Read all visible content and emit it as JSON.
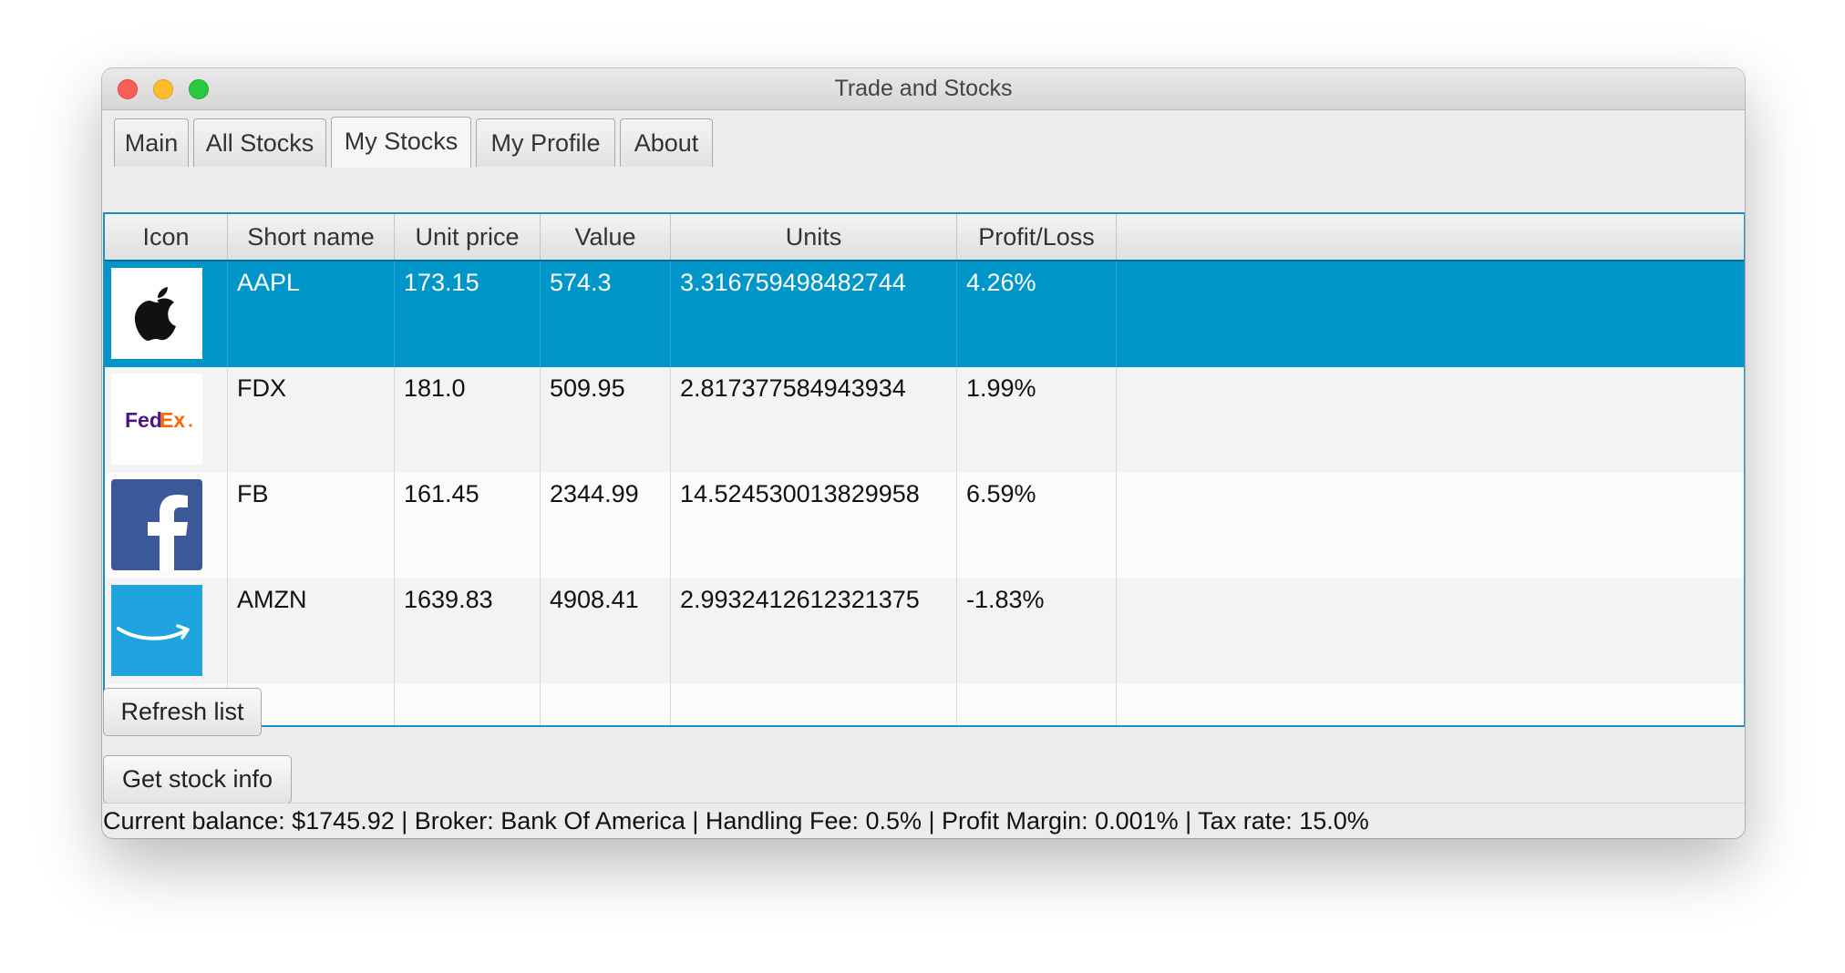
{
  "window": {
    "title": "Trade and Stocks"
  },
  "tabs": [
    {
      "label": "Main"
    },
    {
      "label": "All Stocks"
    },
    {
      "label": "My Stocks",
      "selected": true
    },
    {
      "label": "My Profile"
    },
    {
      "label": "About"
    }
  ],
  "table": {
    "columns": [
      "Icon",
      "Short name",
      "Unit price",
      "Value",
      "Units",
      "Profit/Loss"
    ],
    "rows": [
      {
        "icon": "apple-logo-icon",
        "short_name": "AAPL",
        "unit_price": "173.15",
        "value": "574.3",
        "units": "3.316759498482744",
        "profit_loss": "4.26%",
        "selected": true
      },
      {
        "icon": "fedex-logo-icon",
        "short_name": "FDX",
        "unit_price": "181.0",
        "value": "509.95",
        "units": "2.817377584943934",
        "profit_loss": "1.99%"
      },
      {
        "icon": "facebook-logo-icon",
        "short_name": "FB",
        "unit_price": "161.45",
        "value": "2344.99",
        "units": "14.524530013829958",
        "profit_loss": "6.59%"
      },
      {
        "icon": "amazon-logo-icon",
        "short_name": "AMZN",
        "unit_price": "1639.83",
        "value": "4908.41",
        "units": "2.9932412612321375",
        "profit_loss": "-1.83%"
      }
    ]
  },
  "buttons": {
    "refresh_label": "Refresh list",
    "info_label": "Get stock info"
  },
  "status_bar": {
    "text": "Current balance: $1745.92 | Broker: Bank Of America | Handling Fee: 0.5% | Profit Margin: 0.001% | Tax rate: 15.0%"
  },
  "logos": {
    "fedex_text_fed": "Fed",
    "fedex_text_ex": "Ex"
  },
  "colors": {
    "selection": "#0096c9",
    "table_border": "#1a8fc4",
    "facebook_blue": "#3b5998",
    "amazon_blue": "#1fa4e0",
    "fedex_purple": "#4d148c",
    "fedex_orange": "#ff6600"
  }
}
